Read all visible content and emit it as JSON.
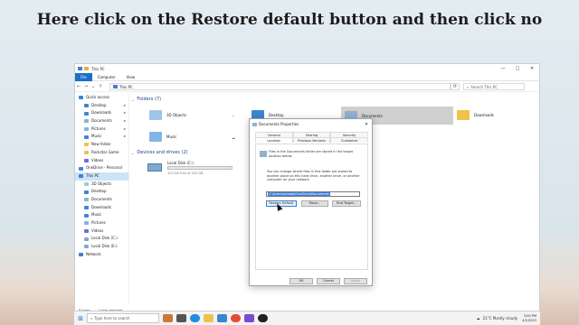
{
  "slide": {
    "title": "Here click on the Restore default button and then click no"
  },
  "window": {
    "title": "This PC",
    "ribbon_tabs": [
      "File",
      "Computer",
      "View"
    ],
    "address": "This PC",
    "search_placeholder": "Search This PC",
    "status_items": "9 items",
    "status_selected": "1 item selected"
  },
  "sidebar": {
    "items": [
      {
        "label": "Quick access",
        "icon": "star-icon"
      },
      {
        "label": "Desktop",
        "icon": "desktop-icon",
        "pinned": true
      },
      {
        "label": "Downloads",
        "icon": "download-icon",
        "pinned": true
      },
      {
        "label": "Documents",
        "icon": "documents-icon",
        "pinned": true
      },
      {
        "label": "Pictures",
        "icon": "pictures-icon",
        "pinned": true
      },
      {
        "label": "Music",
        "icon": "music-icon",
        "pinned": true
      },
      {
        "label": "New folder",
        "icon": "folder-icon"
      },
      {
        "label": "Rockstar Game",
        "icon": "folder-icon"
      },
      {
        "label": "Videos",
        "icon": "videos-icon"
      },
      {
        "label": "OneDrive - Personal",
        "icon": "cloud-icon"
      },
      {
        "label": "This PC",
        "icon": "computer-icon",
        "selected": true
      },
      {
        "label": "3D Objects",
        "icon": "cube-icon"
      },
      {
        "label": "Desktop",
        "icon": "desktop-icon"
      },
      {
        "label": "Documents",
        "icon": "documents-icon"
      },
      {
        "label": "Downloads",
        "icon": "download-icon"
      },
      {
        "label": "Music",
        "icon": "music-icon"
      },
      {
        "label": "Pictures",
        "icon": "pictures-icon"
      },
      {
        "label": "Videos",
        "icon": "videos-icon"
      },
      {
        "label": "Local Disk (C:)",
        "icon": "drive-icon"
      },
      {
        "label": "Local Disk (E:)",
        "icon": "drive-icon"
      },
      {
        "label": "Network",
        "icon": "network-icon"
      }
    ]
  },
  "main": {
    "folders_header": "Folders (7)",
    "folders": [
      {
        "label": "3D Objects"
      },
      {
        "label": "Desktop"
      },
      {
        "label": "Documents"
      },
      {
        "label": "Downloads"
      },
      {
        "label": "Music"
      }
    ],
    "drives_header": "Devices and drives (2)",
    "drive": {
      "name": "Local Disk (C:)",
      "free": "103 GB free of 155 GB",
      "fill_fraction": 0.34
    }
  },
  "dialog": {
    "title": "Documents Properties",
    "tabs_row1": [
      "General",
      "Sharing",
      "Security"
    ],
    "tabs_row2": [
      "Location",
      "Previous Versions",
      "Customize"
    ],
    "text1": "Files in the Documents folder are stored in the target location below.",
    "text2": "You can change where files in this folder are stored to another place on this hard drive, another drive, or another computer on your network.",
    "path": "C:\\Users\\arbaba\\OneDrive\\Documents",
    "btn_restore": "Restore Default",
    "btn_move": "Move...",
    "btn_find": "Find Target...",
    "btn_ok": "OK",
    "btn_cancel": "Cancel",
    "btn_apply": "Apply"
  },
  "taskbar": {
    "search_placeholder": "Type here to search",
    "weather": "21°C  Mostly cloudy",
    "time": "3:00 PM",
    "date": "4/1/2023"
  },
  "colors": {
    "accent": "#1a6fc7",
    "folder": "#f0c24a",
    "selection": "#cce4f7"
  }
}
